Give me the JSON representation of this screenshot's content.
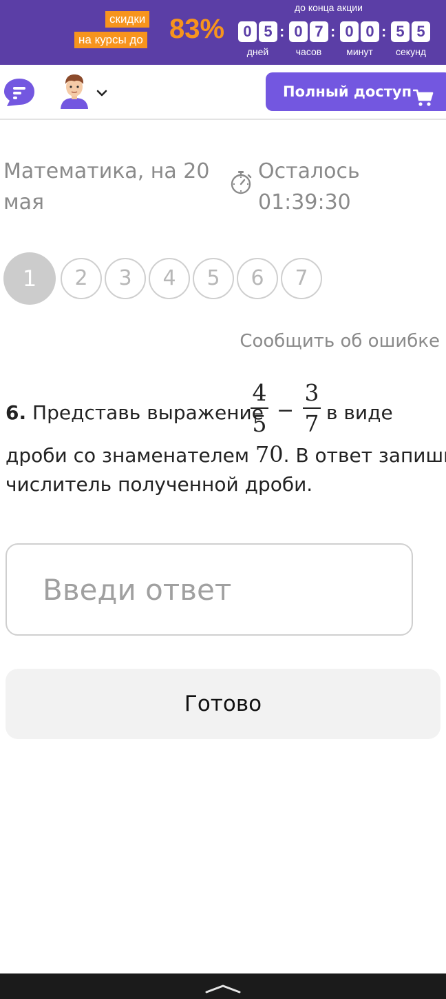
{
  "promo": {
    "tag_line1": "скидки",
    "tag_line2": "на курсы до",
    "percent": "83%",
    "countdown_title": "до конца акции",
    "digits": [
      "0",
      "5",
      "0",
      "7",
      "0",
      "0",
      "5",
      "5"
    ],
    "colon": ":",
    "units": [
      "дней",
      "часов",
      "минут",
      "секунд"
    ],
    "colors": {
      "background": "#5b3ea6",
      "accent": "#f7941d"
    }
  },
  "header": {
    "logo_icon": "chat-bubble-logo-icon",
    "avatar_icon": "user-avatar-icon",
    "dropdown_icon": "chevron-down-icon",
    "full_access_label": "Полный доступ",
    "cart_icon": "cart-icon",
    "colors": {
      "button": "#7357e0"
    }
  },
  "test": {
    "title": "Математика, на 20 мая",
    "timer_icon": "stopwatch-icon",
    "timer_label": "Осталось 01:39:30"
  },
  "question_nav": {
    "items": [
      "1",
      "2",
      "3",
      "4",
      "5",
      "6",
      "7"
    ],
    "active_index": 0
  },
  "report_link": "Сообщить об ошибке",
  "problem": {
    "number": "6.",
    "text_before": "Представь выражение",
    "frac1_num": "4",
    "frac1_den": "5",
    "operator": "−",
    "frac2_num": "3",
    "frac2_den": "7",
    "text_after": "в виде",
    "line2_before": "дроби со знаменателем",
    "denominator": "70",
    "line2_after": ". В ответ запиши",
    "line3": "числитель полученной дроби."
  },
  "answer": {
    "placeholder": "Введи ответ",
    "value": ""
  },
  "done_label": "Готово",
  "bottom_bar": {
    "handle_icon": "chevron-up-icon"
  }
}
